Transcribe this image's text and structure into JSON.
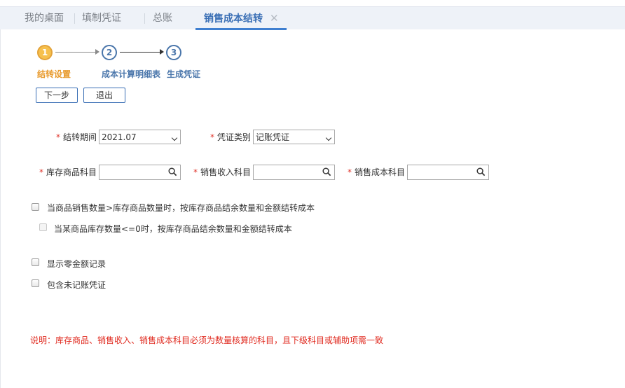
{
  "tabs": [
    {
      "label": "我的桌面"
    },
    {
      "label": "填制凭证"
    },
    {
      "label": "总账"
    },
    {
      "label": "销售成本结转",
      "close": "✕"
    }
  ],
  "steps": [
    {
      "number": "1",
      "label": "结转设置"
    },
    {
      "number": "2",
      "label": "成本计算明细表"
    },
    {
      "number": "3",
      "label": "生成凭证"
    }
  ],
  "buttons": {
    "next": "下一步",
    "exit": "退出"
  },
  "form": {
    "required_mark": "*",
    "period_label": "结转期间",
    "period_value": "2021.07",
    "voucher_type_label": "凭证类别",
    "voucher_type_value": "记账凭证",
    "inventory_account_label": "库存商品科目",
    "sales_income_account_label": "销售收入科目",
    "sales_cost_account_label": "销售成本科目"
  },
  "options": {
    "opt1": "当商品销售数量>库存商品数量时，按库存商品结余数量和金额结转成本",
    "opt2": "当某商品库存数量<=0时，按库存商品结余数量和金额结转成本",
    "opt3": "显示零金额记录",
    "opt4": "包含未记账凭证"
  },
  "note": "说明：库存商品、销售收入、销售成本科目必须为数量核算的科目，且下级科目或辅助项需一致",
  "colors": {
    "accent": "#3a6fb5",
    "active_step": "#e89a2c",
    "required": "#e0352b",
    "note": "#e02b20"
  }
}
